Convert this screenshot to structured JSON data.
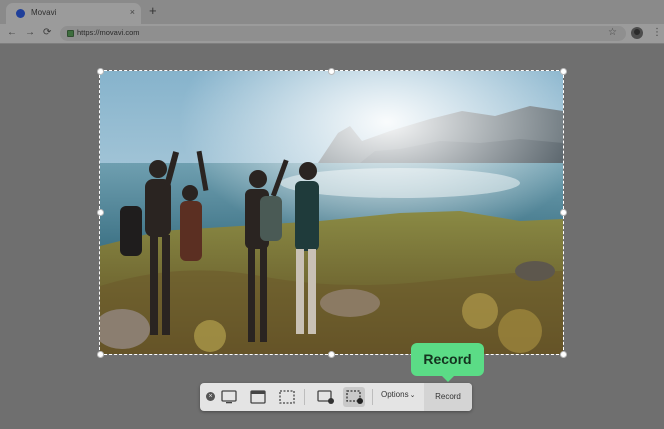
{
  "browser": {
    "tab_title": "Movavi",
    "tab_close": "×",
    "new_tab": "+",
    "back": "←",
    "forward": "→",
    "reload": "⟳",
    "url": "https://movavi.com",
    "bookmark": "☆",
    "menu": "⋮"
  },
  "toolbar": {
    "close_glyph": "×",
    "options_label": "Options",
    "options_chevron": "⌄",
    "record_label": "Record",
    "modes": [
      {
        "name": "fullscreen",
        "active": false
      },
      {
        "name": "window",
        "active": false
      },
      {
        "name": "region",
        "active": false
      },
      {
        "name": "fullscreen-record",
        "active": false
      },
      {
        "name": "region-record",
        "active": true
      }
    ]
  },
  "tooltip": {
    "label": "Record",
    "color": "#5bdc86"
  },
  "colors": {
    "overlay": "#6f6f6f",
    "accent": "#5bdc86"
  }
}
